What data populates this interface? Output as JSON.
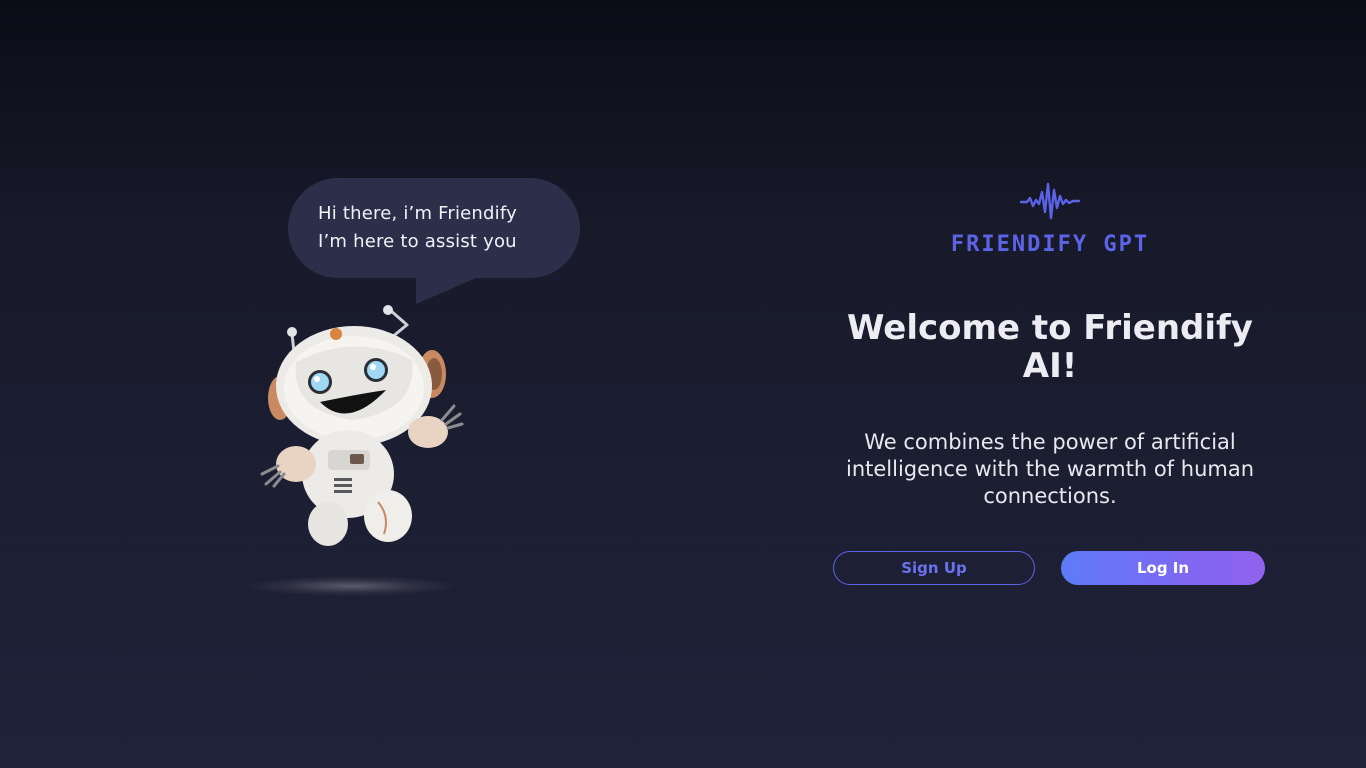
{
  "mascot": {
    "bubble_line_1": "Hi there, i’m Friendify",
    "bubble_line_2": "I’m here to assist you",
    "illustration": "robot-mascot"
  },
  "brand": {
    "logo_icon": "soundwave-icon",
    "logo_text": "FRIENDIFY GPT",
    "accent_color": "#5b63e6"
  },
  "welcome": {
    "title": "Welcome to Friendify AI!",
    "description": "We combines the power of artificial intelligence with the warmth of human connections."
  },
  "actions": {
    "signup_label": "Sign Up",
    "login_label": "Log In",
    "login_gradient": [
      "#5e7cf7",
      "#9162ee"
    ]
  }
}
